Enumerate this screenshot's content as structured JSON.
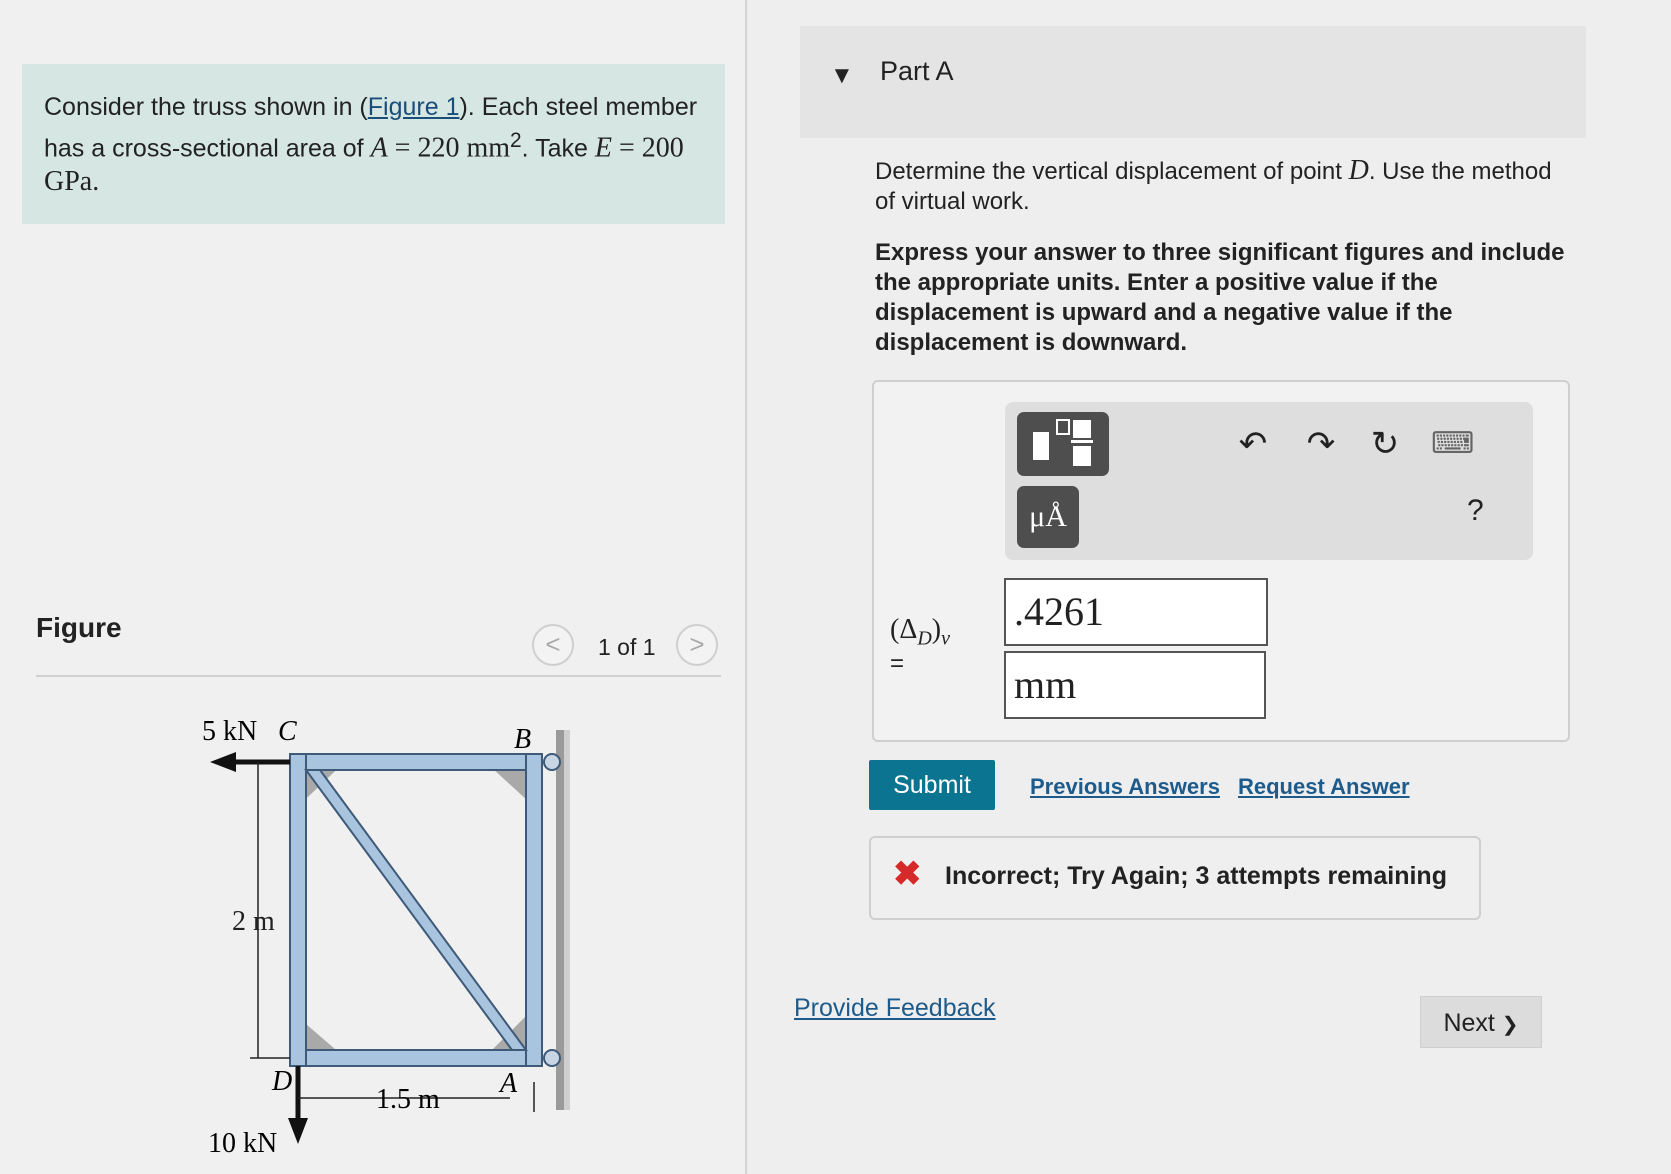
{
  "problem": {
    "text_before": "Consider the truss shown in (",
    "figure_link": "Figure 1",
    "text_mid": "). Each steel member has a cross-sectional area of ",
    "area_symbol": "A",
    "area_value": " = 220 mm",
    "area_exp": "2",
    "text_take": ". Take ",
    "e_symbol": "E",
    "e_value": " = 200 GPa."
  },
  "figure": {
    "label": "Figure",
    "pager_prev": "<",
    "pager_count": "1 of 1",
    "pager_next": ">",
    "truss": {
      "load_c": "5 kN",
      "node_c": "C",
      "node_b": "B",
      "node_d": "D",
      "node_a": "A",
      "height": "2 m",
      "width": "1.5 m",
      "load_d": "10 kN"
    }
  },
  "part": {
    "title": "Part A",
    "caret": "▼",
    "question_pre": "Determine the vertical displacement of point ",
    "question_symbol": "D",
    "question_post": ". Use the method of virtual work.",
    "instructions": "Express your answer to three significant figures and include the appropriate units. Enter a positive value if the displacement is upward and a negative value if the displacement is downward."
  },
  "toolbar": {
    "units_label": "μÅ",
    "undo": "↶",
    "redo": "↷",
    "reset": "↻",
    "keyboard": "⌨",
    "help": "?"
  },
  "answer": {
    "label": "(Δ",
    "label_sub": "D",
    "label_close": ")",
    "label_sub2": "v",
    "equals": "=",
    "value": ".4261",
    "unit": "mm"
  },
  "actions": {
    "submit": "Submit",
    "previous_answers": "Previous Answers",
    "request_answer": "Request Answer"
  },
  "feedback": {
    "icon": "✖",
    "text": "Incorrect; Try Again; 3 attempts remaining"
  },
  "footer": {
    "provide_feedback": "Provide Feedback",
    "next": "Next",
    "next_chevron": "❯"
  }
}
